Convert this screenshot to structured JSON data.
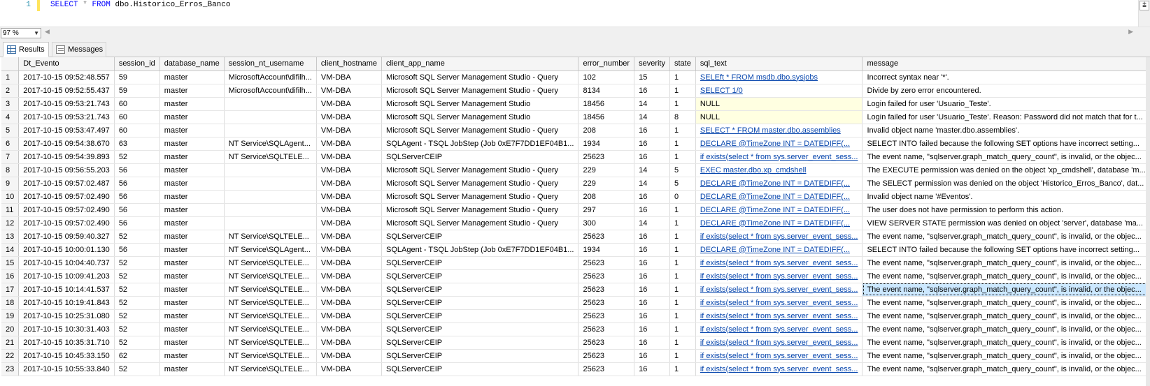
{
  "editor": {
    "line_number": "1",
    "query": {
      "kw1": "SELECT",
      "star": "*",
      "kw2": "FROM",
      "table": "dbo.Historico_Erros_Banco"
    }
  },
  "zoom": {
    "value": "97 %"
  },
  "tabs": {
    "results": "Results",
    "messages": "Messages"
  },
  "grid": {
    "columns": [
      "Dt_Evento",
      "session_id",
      "database_name",
      "session_nt_username",
      "client_hostname",
      "client_app_name",
      "error_number",
      "severity",
      "state",
      "sql_text",
      "message"
    ],
    "rows": [
      [
        "1",
        "2017-10-15 09:52:48.557",
        "59",
        "master",
        "MicrosoftAccount\\difilh...",
        "VM-DBA",
        "Microsoft SQL Server Management Studio - Query",
        "102",
        "15",
        "1",
        "SELEft * FROM msdb.dbo.sysjobs",
        "Incorrect syntax near '*'."
      ],
      [
        "2",
        "2017-10-15 09:52:55.437",
        "59",
        "master",
        "MicrosoftAccount\\difilh...",
        "VM-DBA",
        "Microsoft SQL Server Management Studio - Query",
        "8134",
        "16",
        "1",
        "SELECT 1/0",
        "Divide by zero error encountered."
      ],
      [
        "3",
        "2017-10-15 09:53:21.743",
        "60",
        "master",
        "",
        "VM-DBA",
        "Microsoft SQL Server Management Studio",
        "18456",
        "14",
        "1",
        "NULL",
        "Login failed for user 'Usuario_Teste'."
      ],
      [
        "4",
        "2017-10-15 09:53:21.743",
        "60",
        "master",
        "",
        "VM-DBA",
        "Microsoft SQL Server Management Studio",
        "18456",
        "14",
        "8",
        "NULL",
        "Login failed for user 'Usuario_Teste'. Reason: Password did not match that for t..."
      ],
      [
        "5",
        "2017-10-15 09:53:47.497",
        "60",
        "master",
        "",
        "VM-DBA",
        "Microsoft SQL Server Management Studio - Query",
        "208",
        "16",
        "1",
        "SELECT * FROM master.dbo.assemblies",
        "Invalid object name 'master.dbo.assemblies'."
      ],
      [
        "6",
        "2017-10-15 09:54:38.670",
        "63",
        "master",
        "NT Service\\SQLAgent...",
        "VM-DBA",
        "SQLAgent - TSQL JobStep (Job 0xE7F7DD1EF04B1...",
        "1934",
        "16",
        "1",
        "DECLARE @TimeZone INT = DATEDIFF(...",
        "SELECT INTO failed because the following SET options have incorrect setting..."
      ],
      [
        "7",
        "2017-10-15 09:54:39.893",
        "52",
        "master",
        "NT Service\\SQLTELE...",
        "VM-DBA",
        "SQLServerCEIP",
        "25623",
        "16",
        "1",
        "if exists(select * from sys.server_event_sess...",
        "The event name, \"sqlserver.graph_match_query_count\", is invalid, or the objec..."
      ],
      [
        "8",
        "2017-10-15 09:56:55.203",
        "56",
        "master",
        "",
        "VM-DBA",
        "Microsoft SQL Server Management Studio - Query",
        "229",
        "14",
        "5",
        "EXEC master.dbo.xp_cmdshell",
        "The EXECUTE permission was denied on the object 'xp_cmdshell', database 'm..."
      ],
      [
        "9",
        "2017-10-15 09:57:02.487",
        "56",
        "master",
        "",
        "VM-DBA",
        "Microsoft SQL Server Management Studio - Query",
        "229",
        "14",
        "5",
        "DECLARE @TimeZone INT = DATEDIFF(...",
        "The SELECT permission was denied on the object 'Historico_Erros_Banco', dat..."
      ],
      [
        "10",
        "2017-10-15 09:57:02.490",
        "56",
        "master",
        "",
        "VM-DBA",
        "Microsoft SQL Server Management Studio - Query",
        "208",
        "16",
        "0",
        "DECLARE @TimeZone INT = DATEDIFF(...",
        "Invalid object name '#Eventos'."
      ],
      [
        "11",
        "2017-10-15 09:57:02.490",
        "56",
        "master",
        "",
        "VM-DBA",
        "Microsoft SQL Server Management Studio - Query",
        "297",
        "16",
        "1",
        "DECLARE @TimeZone INT = DATEDIFF(...",
        "The user does not have permission to perform this action."
      ],
      [
        "12",
        "2017-10-15 09:57:02.490",
        "56",
        "master",
        "",
        "VM-DBA",
        "Microsoft SQL Server Management Studio - Query",
        "300",
        "14",
        "1",
        "DECLARE @TimeZone INT = DATEDIFF(...",
        "VIEW SERVER STATE permission was denied on object 'server', database 'ma..."
      ],
      [
        "13",
        "2017-10-15 09:59:40.327",
        "52",
        "master",
        "NT Service\\SQLTELE...",
        "VM-DBA",
        "SQLServerCEIP",
        "25623",
        "16",
        "1",
        "if exists(select * from sys.server_event_sess...",
        "The event name, \"sqlserver.graph_match_query_count\", is invalid, or the objec..."
      ],
      [
        "14",
        "2017-10-15 10:00:01.130",
        "56",
        "master",
        "NT Service\\SQLAgent...",
        "VM-DBA",
        "SQLAgent - TSQL JobStep (Job 0xE7F7DD1EF04B1...",
        "1934",
        "16",
        "1",
        "DECLARE @TimeZone INT = DATEDIFF(...",
        "SELECT INTO failed because the following SET options have incorrect setting..."
      ],
      [
        "15",
        "2017-10-15 10:04:40.737",
        "52",
        "master",
        "NT Service\\SQLTELE...",
        "VM-DBA",
        "SQLServerCEIP",
        "25623",
        "16",
        "1",
        "if exists(select * from sys.server_event_sess...",
        "The event name, \"sqlserver.graph_match_query_count\", is invalid, or the objec..."
      ],
      [
        "16",
        "2017-10-15 10:09:41.203",
        "52",
        "master",
        "NT Service\\SQLTELE...",
        "VM-DBA",
        "SQLServerCEIP",
        "25623",
        "16",
        "1",
        "if exists(select * from sys.server_event_sess...",
        "The event name, \"sqlserver.graph_match_query_count\", is invalid, or the objec..."
      ],
      [
        "17",
        "2017-10-15 10:14:41.537",
        "52",
        "master",
        "NT Service\\SQLTELE...",
        "VM-DBA",
        "SQLServerCEIP",
        "25623",
        "16",
        "1",
        "if exists(select * from sys.server_event_sess...",
        "The event name, \"sqlserver.graph_match_query_count\", is invalid, or the objec..."
      ],
      [
        "18",
        "2017-10-15 10:19:41.843",
        "52",
        "master",
        "NT Service\\SQLTELE...",
        "VM-DBA",
        "SQLServerCEIP",
        "25623",
        "16",
        "1",
        "if exists(select * from sys.server_event_sess...",
        "The event name, \"sqlserver.graph_match_query_count\", is invalid, or the objec..."
      ],
      [
        "19",
        "2017-10-15 10:25:31.080",
        "52",
        "master",
        "NT Service\\SQLTELE...",
        "VM-DBA",
        "SQLServerCEIP",
        "25623",
        "16",
        "1",
        "if exists(select * from sys.server_event_sess...",
        "The event name, \"sqlserver.graph_match_query_count\", is invalid, or the objec..."
      ],
      [
        "20",
        "2017-10-15 10:30:31.403",
        "52",
        "master",
        "NT Service\\SQLTELE...",
        "VM-DBA",
        "SQLServerCEIP",
        "25623",
        "16",
        "1",
        "if exists(select * from sys.server_event_sess...",
        "The event name, \"sqlserver.graph_match_query_count\", is invalid, or the objec..."
      ],
      [
        "21",
        "2017-10-15 10:35:31.710",
        "52",
        "master",
        "NT Service\\SQLTELE...",
        "VM-DBA",
        "SQLServerCEIP",
        "25623",
        "16",
        "1",
        "if exists(select * from sys.server_event_sess...",
        "The event name, \"sqlserver.graph_match_query_count\", is invalid, or the objec..."
      ],
      [
        "22",
        "2017-10-15 10:45:33.150",
        "62",
        "master",
        "NT Service\\SQLTELE...",
        "VM-DBA",
        "SQLServerCEIP",
        "25623",
        "16",
        "1",
        "if exists(select * from sys.server_event_sess...",
        "The event name, \"sqlserver.graph_match_query_count\", is invalid, or the objec..."
      ],
      [
        "23",
        "2017-10-15 10:55:33.840",
        "52",
        "master",
        "NT Service\\SQLTELE...",
        "VM-DBA",
        "SQLServerCEIP",
        "25623",
        "16",
        "1",
        "if exists(select * from sys.server_event_sess...",
        "The event name, \"sqlserver.graph_match_query_count\", is invalid, or the objec..."
      ]
    ],
    "selected_row": 17
  }
}
